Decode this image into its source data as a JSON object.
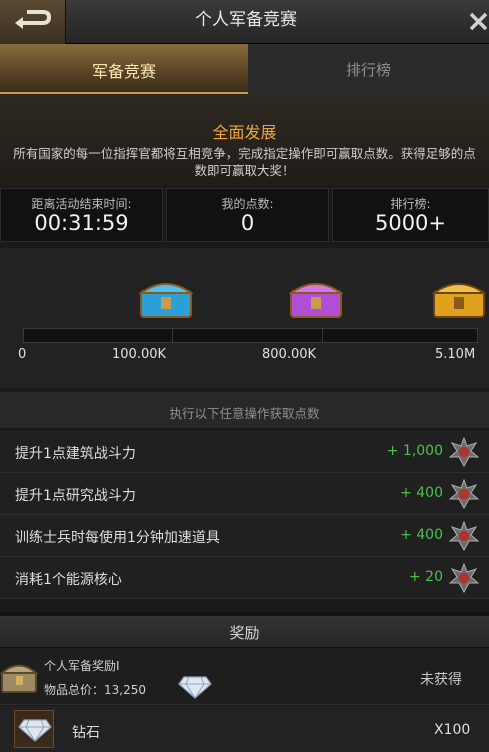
{
  "header": {
    "title": "个人军备竞赛",
    "back_icon": "back-arrow-icon",
    "close_icon": "close-icon"
  },
  "tabs": [
    {
      "label": "军备竞赛",
      "active": true
    },
    {
      "label": "排行榜",
      "active": false
    }
  ],
  "banner": {
    "title": "全面发展",
    "description": "所有国家的每一位指挥官都将互相竞争，完成指定操作即可赢取点数。获得足够的点数即可赢取大奖！"
  },
  "stats": [
    {
      "label": "距离活动结束时间:",
      "value": "00:31:59"
    },
    {
      "label": "我的点数:",
      "value": "0"
    },
    {
      "label": "排行榜:",
      "value": "5000+"
    }
  ],
  "milestones": {
    "progress": 0,
    "labels": [
      "0",
      "100.00K",
      "800.00K",
      "5.10M"
    ],
    "chests": [
      {
        "icon": "blue-chest-icon",
        "color": "#2a9fd8"
      },
      {
        "icon": "purple-chest-icon",
        "color": "#b04ed6"
      },
      {
        "icon": "gold-chest-icon",
        "color": "#e0a21e"
      }
    ]
  },
  "tasks": {
    "heading": "执行以下任意操作获取点数",
    "items": [
      {
        "label": "提升1点建筑战斗力",
        "points": "+ 1,000"
      },
      {
        "label": "提升1点研究战斗力",
        "points": "+ 400"
      },
      {
        "label": "训练士兵时每使用1分钟加速道具",
        "points": "+ 400"
      },
      {
        "label": "消耗1个能源核心",
        "points": "+ 20"
      }
    ]
  },
  "rewards": {
    "heading": "奖励",
    "reward_name": "个人军备奖励I",
    "total_value": "物品总价：13,250",
    "status": "未获得",
    "item_name": "钻石",
    "item_qty": "X100",
    "item_icon": "diamond-icon"
  },
  "colors": {
    "accent": "#f0a53a",
    "points_green": "#49c24a",
    "active_tab": "#8a6b3a"
  }
}
